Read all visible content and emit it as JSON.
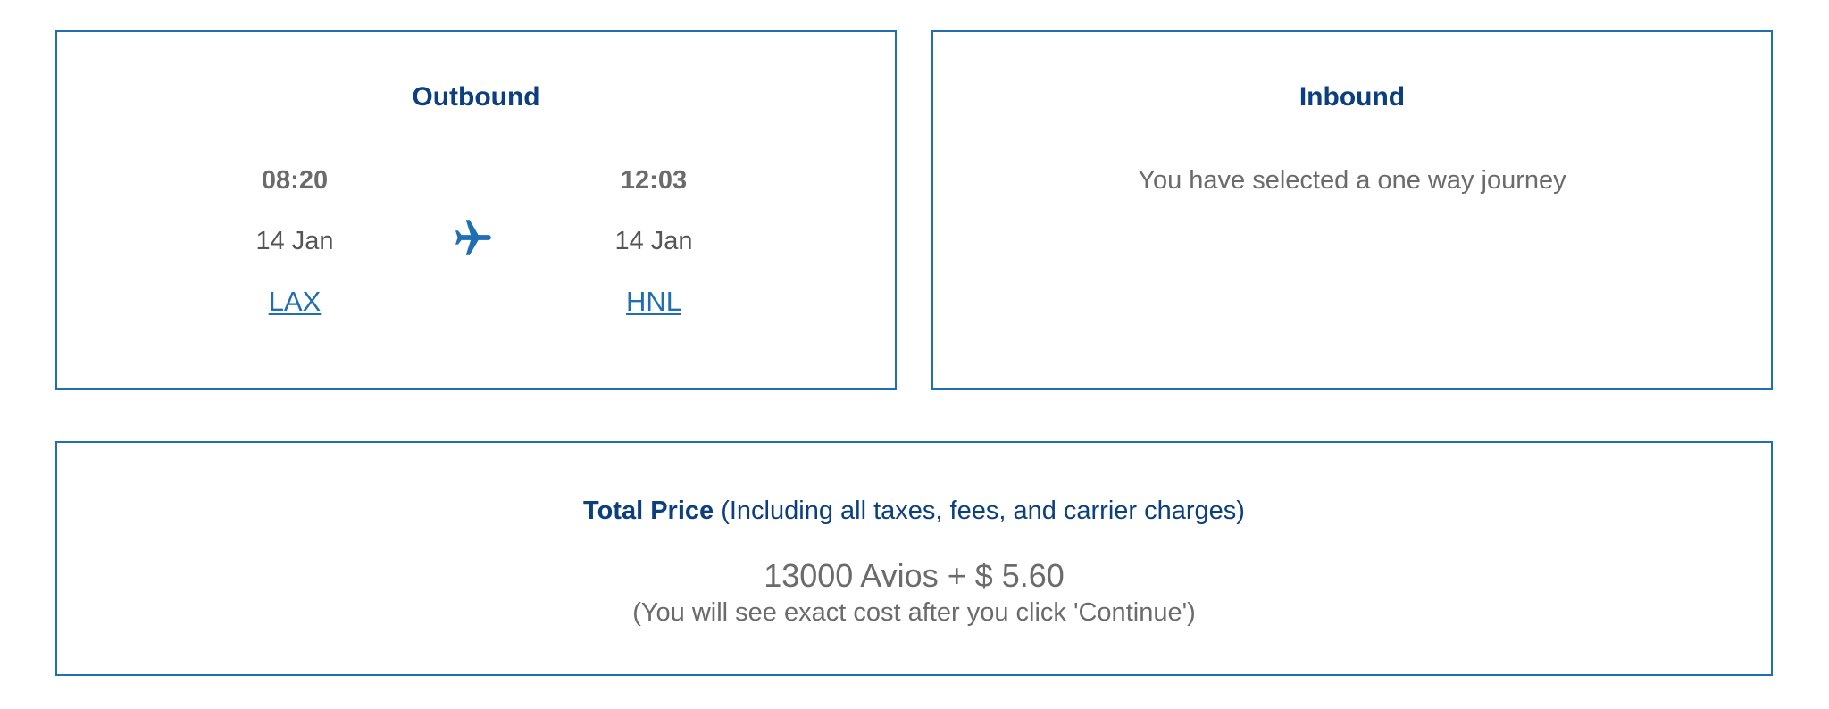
{
  "outbound": {
    "title": "Outbound",
    "departure": {
      "time": "08:20",
      "date": "14 Jan",
      "airport": "LAX"
    },
    "arrival": {
      "time": "12:03",
      "date": "14 Jan",
      "airport": "HNL"
    },
    "icon": "airplane-icon"
  },
  "inbound": {
    "title": "Inbound",
    "message": "You have selected a one way journey"
  },
  "price": {
    "heading_bold": "Total Price",
    "heading_rest": " (Including all taxes, fees, and carrier charges)",
    "amount": "13000 Avios + $ 5.60",
    "note": "(You will see exact cost after you click 'Continue')"
  },
  "colors": {
    "border": "#1f6fb2",
    "title": "#0b3f7f",
    "link": "#1f6fb2",
    "text": "#6b6b6b"
  }
}
